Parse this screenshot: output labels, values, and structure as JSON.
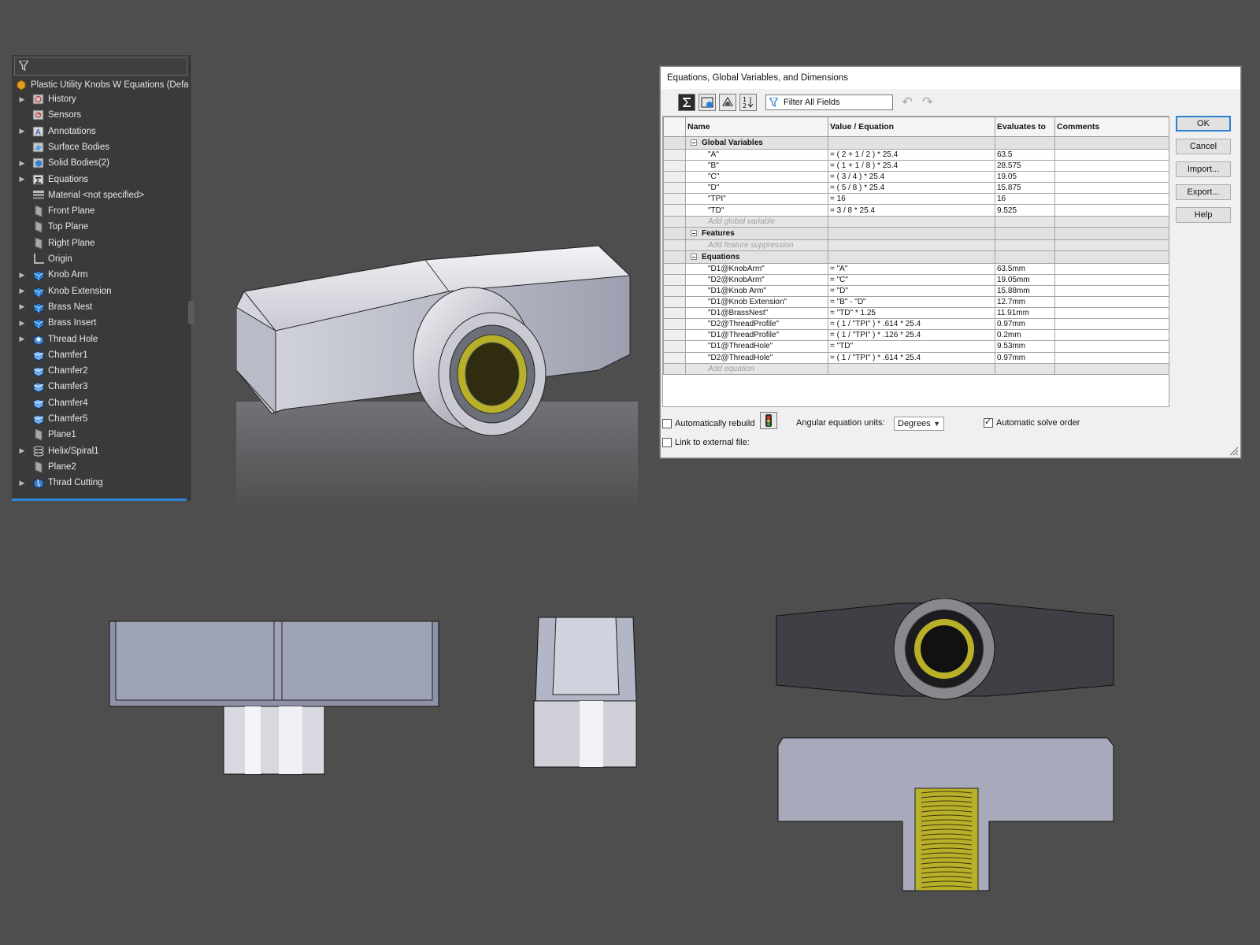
{
  "tree": {
    "root": "Plastic Utility Knobs W Equations  (Defau",
    "items": [
      {
        "label": "History",
        "arrow": true,
        "icon": "history-icon"
      },
      {
        "label": "Sensors",
        "arrow": false,
        "icon": "sensor-icon"
      },
      {
        "label": "Annotations",
        "arrow": true,
        "icon": "annotation-icon"
      },
      {
        "label": "Surface Bodies",
        "arrow": false,
        "icon": "surface-bodies-icon"
      },
      {
        "label": "Solid Bodies(2)",
        "arrow": true,
        "icon": "solid-bodies-icon"
      },
      {
        "label": "Equations",
        "arrow": true,
        "icon": "equations-icon"
      },
      {
        "label": "Material <not specified>",
        "arrow": false,
        "icon": "material-icon"
      },
      {
        "label": "Front Plane",
        "arrow": false,
        "icon": "plane-icon"
      },
      {
        "label": "Top Plane",
        "arrow": false,
        "icon": "plane-icon"
      },
      {
        "label": "Right Plane",
        "arrow": false,
        "icon": "plane-icon"
      },
      {
        "label": "Origin",
        "arrow": false,
        "icon": "origin-icon"
      },
      {
        "label": "Knob Arm",
        "arrow": true,
        "icon": "extrude-icon"
      },
      {
        "label": "Knob Extension",
        "arrow": true,
        "icon": "extrude-icon"
      },
      {
        "label": "Brass Nest",
        "arrow": true,
        "icon": "extrude-icon"
      },
      {
        "label": "Brass Insert",
        "arrow": true,
        "icon": "extrude-icon"
      },
      {
        "label": "Thread Hole",
        "arrow": true,
        "icon": "hole-icon"
      },
      {
        "label": "Chamfer1",
        "arrow": false,
        "icon": "chamfer-icon"
      },
      {
        "label": "Chamfer2",
        "arrow": false,
        "icon": "chamfer-icon"
      },
      {
        "label": "Chamfer3",
        "arrow": false,
        "icon": "chamfer-icon"
      },
      {
        "label": "Chamfer4",
        "arrow": false,
        "icon": "chamfer-icon"
      },
      {
        "label": "Chamfer5",
        "arrow": false,
        "icon": "chamfer-icon"
      },
      {
        "label": "Plane1",
        "arrow": false,
        "icon": "plane-icon"
      },
      {
        "label": "Helix/Spiral1",
        "arrow": true,
        "icon": "helix-icon"
      },
      {
        "label": "Plane2",
        "arrow": false,
        "icon": "plane-icon"
      },
      {
        "label": "Thrad Cutting",
        "arrow": true,
        "icon": "cut-icon"
      }
    ]
  },
  "dialog": {
    "title": "Equations, Global Variables, and Dimensions",
    "filter_label": "Filter All Fields",
    "columns": [
      "Name",
      "Value / Equation",
      "Evaluates to",
      "Comments"
    ],
    "groups": [
      {
        "label": "Global Variables",
        "add": "Add global variable",
        "rows": [
          {
            "name": "\"A\"",
            "value": "= ( 2 + 1 / 2 ) * 25.4",
            "eval": "63.5"
          },
          {
            "name": "\"B\"",
            "value": "= ( 1 + 1 / 8 ) * 25.4",
            "eval": "28.575"
          },
          {
            "name": "\"C\"",
            "value": "= ( 3 / 4 ) * 25.4",
            "eval": "19.05"
          },
          {
            "name": "\"D\"",
            "value": "= ( 5 / 8 ) * 25.4",
            "eval": "15.875"
          },
          {
            "name": "\"TPI\"",
            "value": "= 16",
            "eval": "16"
          },
          {
            "name": "\"TD\"",
            "value": "= 3 / 8 * 25.4",
            "eval": "9.525"
          }
        ]
      },
      {
        "label": "Features",
        "add": "Add feature suppression",
        "rows": []
      },
      {
        "label": "Equations",
        "add": "Add equation",
        "rows": [
          {
            "name": "\"D1@KnobArm\"",
            "value": "= \"A\"",
            "eval": "63.5mm"
          },
          {
            "name": "\"D2@KnobArm\"",
            "value": "= \"C\"",
            "eval": "19.05mm"
          },
          {
            "name": "\"D1@Knob Arm\"",
            "value": "= \"D\"",
            "eval": "15.88mm"
          },
          {
            "name": "\"D1@Knob Extension\"",
            "value": "= \"B\" - \"D\"",
            "eval": "12.7mm"
          },
          {
            "name": "\"D1@BrassNest\"",
            "value": "= \"TD\" * 1.25",
            "eval": "11.91mm"
          },
          {
            "name": "\"D2@ThreadProfile\"",
            "value": "= ( 1 / \"TPI\" ) * .614 * 25.4",
            "eval": "0.97mm"
          },
          {
            "name": "\"D1@ThreadProfile\"",
            "value": "= ( 1 / \"TPI\" ) * .126 * 25.4",
            "eval": "0.2mm"
          },
          {
            "name": "\"D1@ThreadHole\"",
            "value": "= \"TD\"",
            "eval": "9.53mm"
          },
          {
            "name": "\"D2@ThreadHole\"",
            "value": "= ( 1 / \"TPI\" ) * .614 * 25.4",
            "eval": "0.97mm"
          }
        ]
      }
    ],
    "buttons": {
      "ok": "OK",
      "cancel": "Cancel",
      "import": "Import...",
      "export": "Export...",
      "help": "Help"
    },
    "auto_rebuild_label": "Automatically rebuild",
    "auto_rebuild_checked": false,
    "angular_label": "Angular equation units:",
    "angular_value": "Degrees",
    "auto_solve_label": "Automatic solve order",
    "auto_solve_checked": true,
    "link_external_label": "Link to external file:",
    "link_external_checked": false
  },
  "colors": {
    "background": "#4e4e4e",
    "part_grey": "#8e92a6",
    "brass": "#b8b028",
    "accent": "#2d7fd0"
  }
}
